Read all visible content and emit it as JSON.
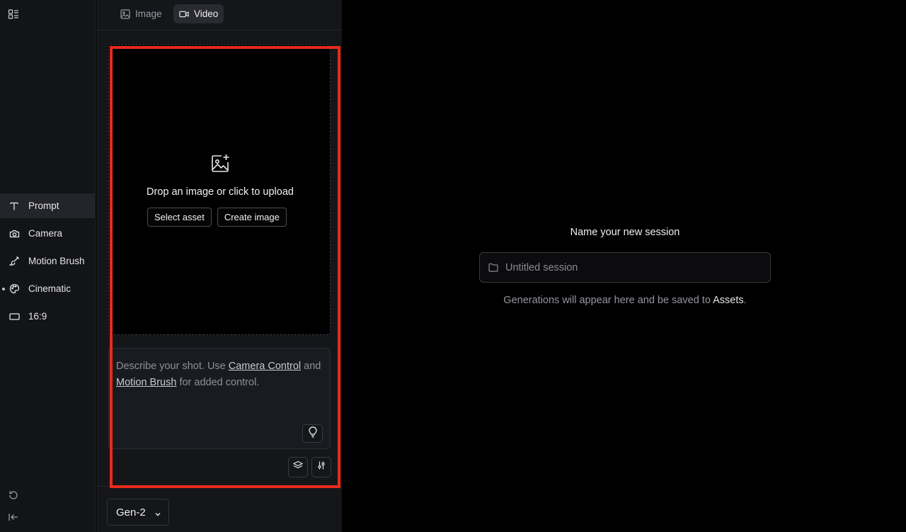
{
  "tabs": [
    {
      "label": "Image",
      "icon": "image-icon",
      "active": false
    },
    {
      "label": "Video",
      "icon": "video-icon",
      "active": true
    }
  ],
  "sidebar": {
    "items": [
      {
        "label": "Prompt",
        "icon": "text-icon",
        "active": true
      },
      {
        "label": "Camera",
        "icon": "camera-icon"
      },
      {
        "label": "Motion Brush",
        "icon": "brush-icon"
      },
      {
        "label": "Cinematic",
        "icon": "palette-icon"
      },
      {
        "label": "16:9",
        "icon": "aspect-ratio-icon"
      }
    ]
  },
  "upload": {
    "text": "Drop an image or click to upload",
    "select_asset": "Select asset",
    "create_image": "Create image"
  },
  "prompt": {
    "part1": "Describe your shot. Use ",
    "link1": "Camera Control",
    "part2": " and ",
    "link2": "Motion Brush",
    "part3": " for added control."
  },
  "model": {
    "label": "Gen-2"
  },
  "session": {
    "title": "Name your new session",
    "placeholder": "Untitled session",
    "hint": "Generations will appear here and be saved to ",
    "hint_link": "Assets",
    "hint_end": "."
  },
  "colors": {
    "highlight": "#ea2a1a",
    "background": "#000000",
    "panel": "#15161a"
  }
}
